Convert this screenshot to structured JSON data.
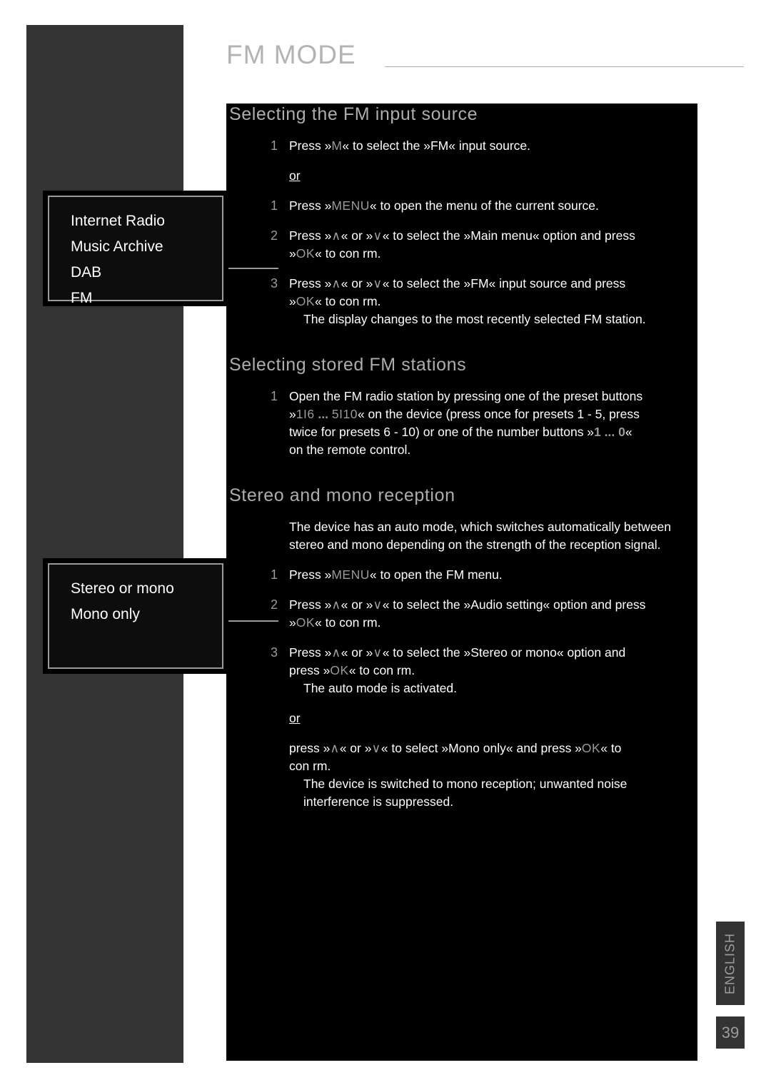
{
  "header": {
    "title": "FM MODE"
  },
  "sections": [
    {
      "heading": "Selecting the FM input source",
      "steps": [
        {
          "num": "1",
          "text_before": "Press »",
          "key1": "M",
          "text_after": "« to select the »FM« input source."
        }
      ],
      "or_label": "or",
      "steps2": [
        {
          "num": "1",
          "line1_a": "Press »",
          "key": "MENU",
          "line1_b": "« to open the menu of the current source."
        },
        {
          "num": "2",
          "line1_a": "Press »",
          "key_up": "∧",
          "line1_b": "« or »",
          "key_dn": "∨",
          "line1_c": "« to select the »Main menu« option and press",
          "line2_a": "»",
          "key_ok": "OK",
          "line2_b": "« to con rm."
        },
        {
          "num": "3",
          "line1_a": "Press »",
          "key_up": "∧",
          "line1_b": "« or »",
          "key_dn": "∨",
          "line1_c": "« to select the »FM« input source and press",
          "line2_a": "»",
          "key_ok": "OK",
          "line2_b": "« to con rm.",
          "result": "The display changes to the most recently selected FM station."
        }
      ]
    }
  ],
  "section1": {
    "heading": "Selecting the FM input source",
    "step1": {
      "num": "1",
      "a": "Press »",
      "key": "M",
      "b": "« to select the »FM« input source."
    },
    "or": "or",
    "step1b": {
      "num": "1",
      "a": "Press »",
      "key": "MENU",
      "b": "« to open the menu of the current source."
    },
    "step2": {
      "num": "2",
      "a": "Press »",
      "key_up": "∧",
      "b": "« or »",
      "key_dn": "∨",
      "c": "« to select the »Main menu« option and press",
      "d": "»",
      "key_ok": "OK",
      "e": "« to con rm."
    },
    "step3": {
      "num": "3",
      "a": "Press »",
      "key_up": "∧",
      "b": "« or »",
      "key_dn": "∨",
      "c": "« to select the »FM« input source and press",
      "d": "»",
      "key_ok": "OK",
      "e": "« to con rm.",
      "result": "The display changes to the most recently selected FM station."
    }
  },
  "section2": {
    "heading": "Selecting stored FM stations",
    "step1": {
      "num": "1",
      "l1": "Open the FM radio station by pressing one of the preset buttons",
      "l2_a": "»",
      "l2_key1": "1I6",
      "l2_dots": " ... ",
      "l2_key2": "5I10",
      "l2_b": "« on the device (press once for presets 1 - 5, press",
      "l3_a": "twice for presets 6 - 10) or one of the number buttons »",
      "l3_key": "1 ... 0",
      "l3_b": "«",
      "l4": "on the remote control."
    }
  },
  "section3": {
    "heading": "Stereo and mono reception",
    "intro_l1": "The device has an auto mode, which switches automatically between",
    "intro_l2": "stereo and mono depending on the strength of the reception signal.",
    "step1": {
      "num": "1",
      "a": "Press »",
      "key": "MENU",
      "b": "« to open the FM menu."
    },
    "step2": {
      "num": "2",
      "a": "Press »",
      "key_up": "∧",
      "b": "« or »",
      "key_dn": "∨",
      "c": "« to select the »Audio setting« option and press",
      "d": "»",
      "key_ok": "OK",
      "e": "« to con rm."
    },
    "step3": {
      "num": "3",
      "a": "Press »",
      "key_up": "∧",
      "b": "« or »",
      "key_dn": "∨",
      "c": "« to select the »Stereo or mono« option and",
      "d": "press »",
      "key_ok": "OK",
      "e": "« to con rm.",
      "result": "The auto mode is activated."
    },
    "or": "or",
    "alt": {
      "a": "press »",
      "key_up": "∧",
      "b": "« or »",
      "key_dn": "∨",
      "c": "« to select »Mono only« and press »",
      "key_ok": "OK",
      "d": "« to",
      "e": "con rm.",
      "result_l1": "The device is switched to mono reception; unwanted noise",
      "result_l2": "interference is suppressed."
    }
  },
  "callout_sources": {
    "items": [
      "Internet Radio",
      "Music Archive",
      "DAB",
      "FM"
    ]
  },
  "callout_audio": {
    "items": [
      "Stereo or mono",
      "Mono only"
    ]
  },
  "footer": {
    "language": "ENGLISH",
    "page_number": "39"
  },
  "colors": {
    "page_bg": "#ffffff",
    "band": "#333333",
    "content_bg": "#000000",
    "heading": "#adadad",
    "body_text": "#ffffff",
    "key_text": "#9a9a9a",
    "tab_bg": "#333333",
    "tab_text": "#9d9d9d"
  }
}
